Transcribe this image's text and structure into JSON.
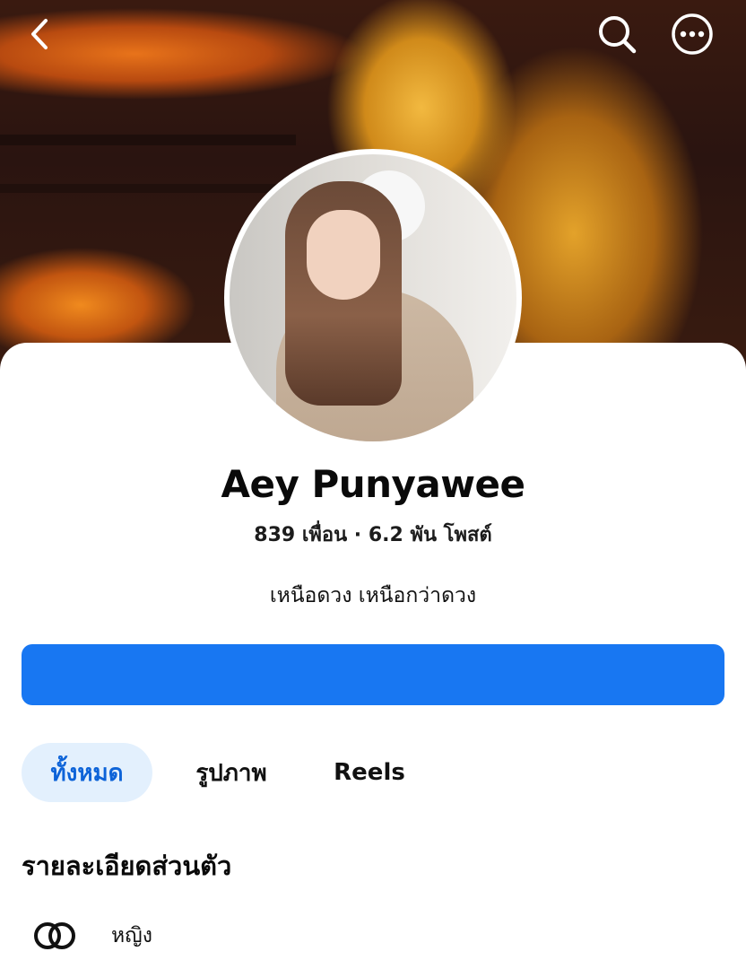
{
  "header": {
    "back_icon": "chevron-left-icon",
    "search_icon": "search-icon",
    "more_icon": "more-horizontal-icon"
  },
  "profile": {
    "name": "Aey Punyawee",
    "stats": "839 เพื่อน · 6.2 พัน โพสต์",
    "bio": "เหนือดวง เหนือกว่าดวง"
  },
  "primary_action": {
    "label": "",
    "color": "#1877f2"
  },
  "tabs": [
    {
      "label": "ทั้งหมด",
      "selected": true
    },
    {
      "label": "รูปภาพ",
      "selected": false
    },
    {
      "label": "Reels",
      "selected": false
    }
  ],
  "details": {
    "title": "รายละเอียดส่วนตัว",
    "items": [
      {
        "icon": "gender-icon",
        "value": "หญิง"
      }
    ]
  },
  "colors": {
    "accent": "#1877f2",
    "selected_tab_bg": "#e3f0fd",
    "selected_tab_text": "#0d63d8"
  }
}
